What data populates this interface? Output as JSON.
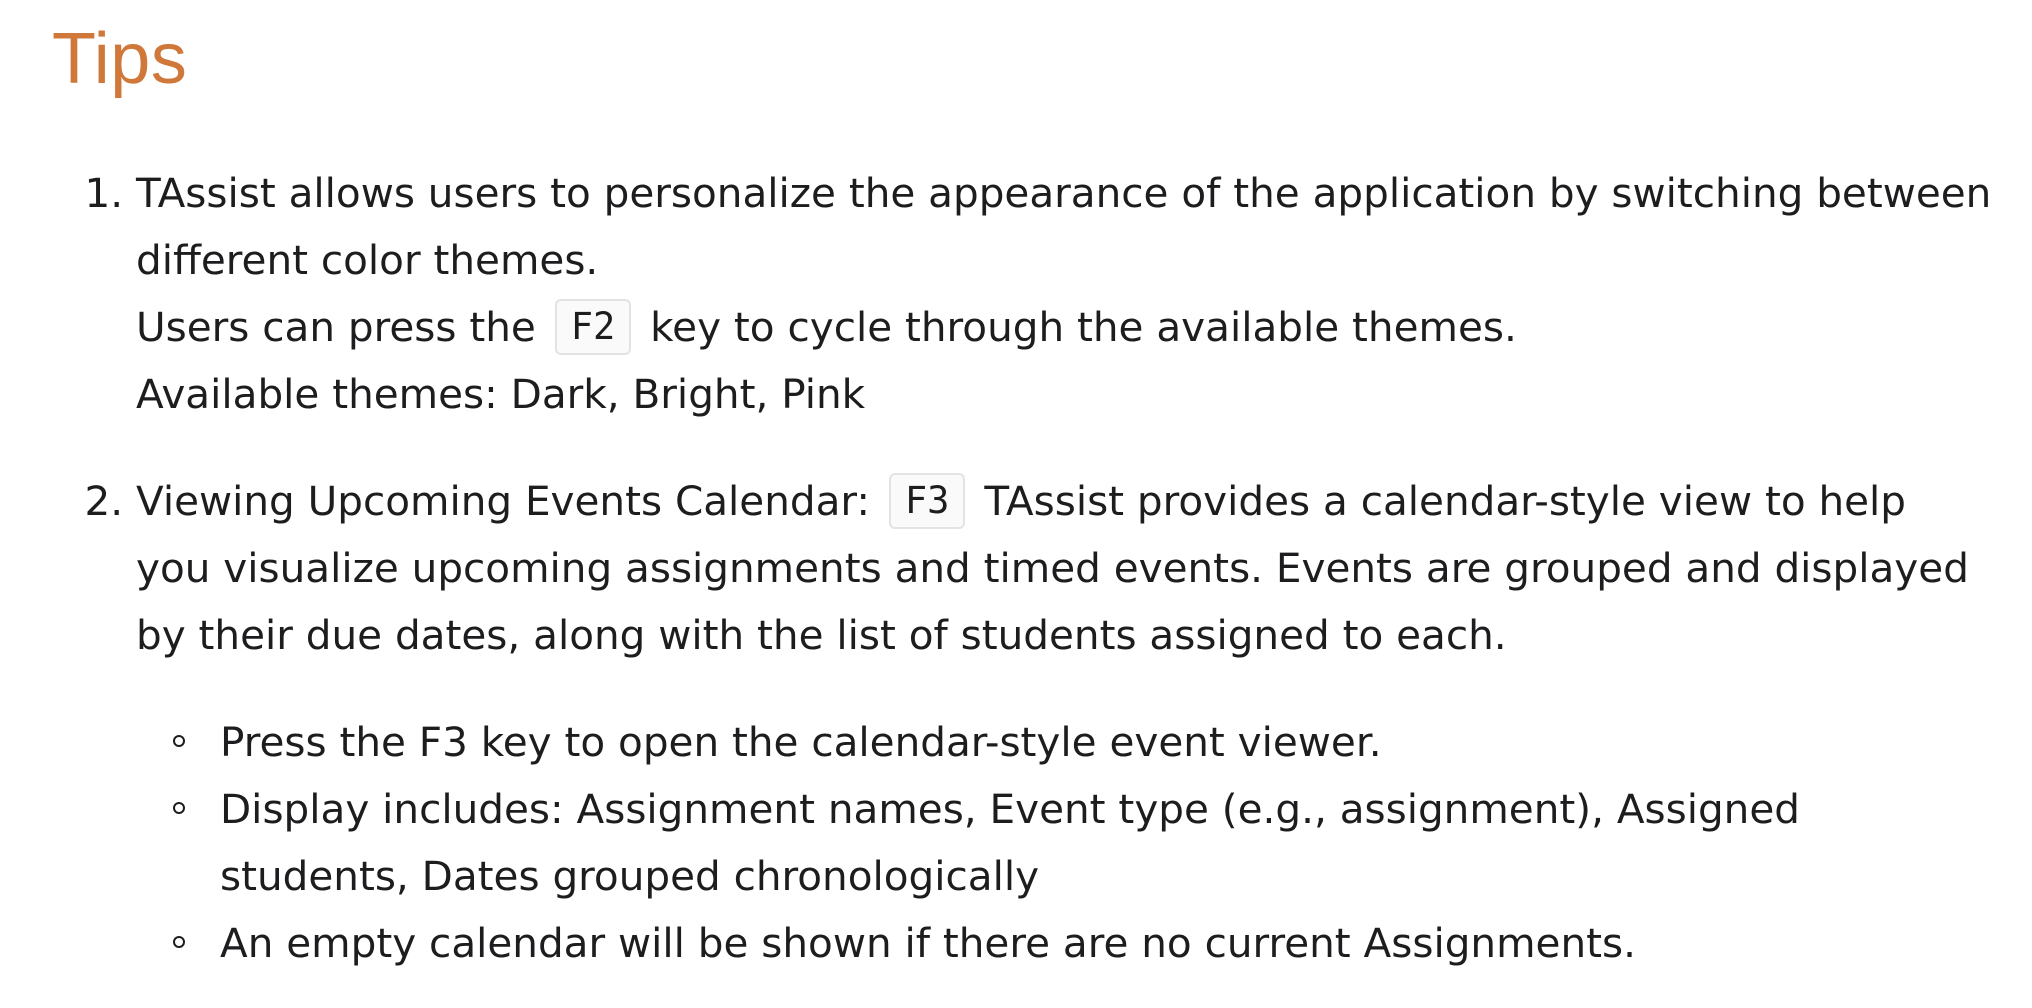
{
  "title": "Tips",
  "tips": [
    {
      "line1": "TAssist allows users to personalize the appearance of the application by switching between different color themes.",
      "line2_before": "Users can press the",
      "line2_key": "F2",
      "line2_after": "key to cycle through the available themes.",
      "line3": "Available themes: Dark, Bright, Pink"
    },
    {
      "before": "Viewing Upcoming Events Calendar:",
      "key": "F3",
      "after": "TAssist provides a calendar-style view to help you visualize upcoming assignments and timed events. Events are grouped and displayed by their due dates, along with the list of students assigned to each.",
      "bullets": [
        "Press the F3 key to open the calendar-style event viewer.",
        "Display includes: Assignment names, Event type (e.g., assignment), Assigned students, Dates grouped chronologically",
        "An empty calendar will be shown if there are no current Assignments."
      ]
    }
  ]
}
